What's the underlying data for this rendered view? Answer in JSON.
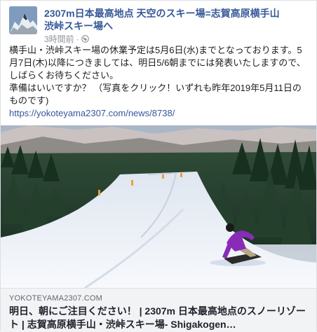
{
  "post": {
    "page_name": "2307m日本最高地点 天空のスキー場=志賀高原横手山渋峠スキー場へ",
    "time": "3時間前",
    "separator": "·",
    "text_line1": "横手山・渋峠スキー場の休業予定は5月6日(水)までとなっております。5月7日(木)以降につきましては、明日5/6朝までには発表いたしますので、しばらくお待ちください。",
    "text_line2": "準備はいいですか？ （写真をクリック！いずれも昨年2019年5月11日のものです)",
    "link_url": "https://yokoteyama2307.com/news/8738/"
  },
  "preview": {
    "domain": "YOKOTEYAMA2307.COM",
    "title": "明日、朝にご注目ください！ | 2307m 日本最高地点のスノーリゾート | 志賀高原横手山・渋峠スキー場- Shigakogen…"
  },
  "icons": {
    "audience": "globe-icon"
  },
  "colors": {
    "link": "#365899",
    "muted": "#90949c",
    "preview_bg": "#f2f3f5",
    "rider_jacket": "#8a2bb8"
  }
}
